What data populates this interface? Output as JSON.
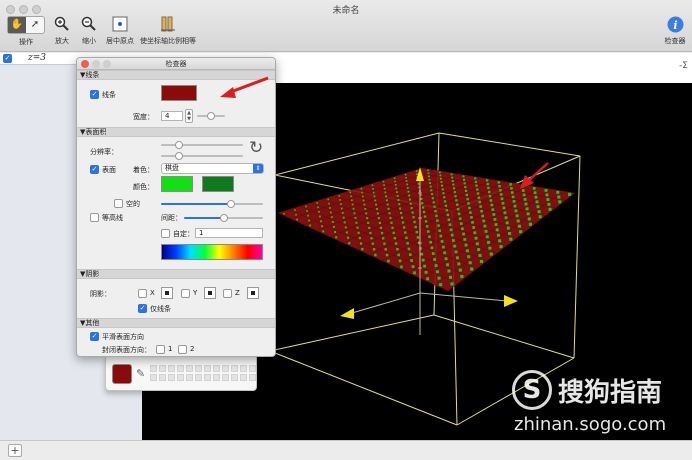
{
  "window": {
    "title": "未命名"
  },
  "toolbar": {
    "mode_label": "操作",
    "zoom_in_label": "放大",
    "zoom_out_label": "缩小",
    "center_label": "居中原点",
    "equal_scale_label": "使坐标轴比例相等",
    "inspector_label": "检查器"
  },
  "sidebar": {
    "equations": [
      {
        "text": "z=3",
        "checked": true
      }
    ]
  },
  "inspector": {
    "title": "检查器",
    "lines": {
      "header": "线条",
      "lines_label": "线条",
      "lines_checked": true,
      "line_color": "#8b0a0a",
      "width_label": "宽度：",
      "width_value": "4"
    },
    "surface": {
      "header": "表面积",
      "resolution_label": "分辨率：",
      "surface_label": "表面",
      "surface_checked": true,
      "coloring_label": "着色：",
      "coloring_value": "棋盘",
      "colors_label": "颜色：",
      "color_a": "#12e012",
      "color_b": "#0f7a1e",
      "hollow_label": "空的",
      "hollow_checked": false,
      "contours_label": "等高线",
      "contours_checked": false,
      "spacing_label": "间距：",
      "custom_label": "自定：",
      "custom_checked": false,
      "custom_value": "1"
    },
    "shadow": {
      "header": "阴影",
      "shadow_label": "阴影：",
      "x_label": "X",
      "y_label": "Y",
      "z_label": "Z",
      "lines_only_label": "仅线条",
      "lines_only_checked": true
    },
    "other": {
      "header": "其他",
      "smooth_label": "平滑表面方向",
      "smooth_checked": true,
      "closed_label": "封闭表面方向：",
      "opt1": "1",
      "opt2": "2"
    }
  },
  "palette": {
    "selected_color": "#8b0a0a"
  },
  "canvas": {
    "background": "#000000",
    "plane_color": "#8b1010",
    "check_color": "#1fc21f",
    "box_color": "#e0e07a",
    "arrow_color": "#f0e020",
    "annotation_color": "#d81e1e"
  },
  "watermark": {
    "logo": "S",
    "brand": "搜狗指南",
    "url": "zhinan.sogo.com"
  }
}
